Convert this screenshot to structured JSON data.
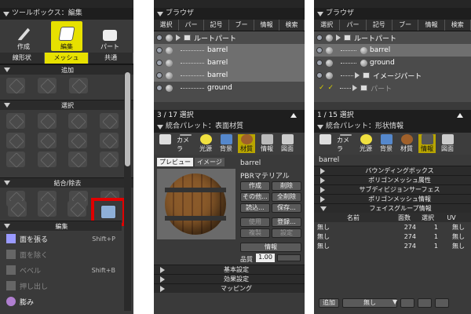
{
  "toolbox": {
    "title": "ツールボックス：編集",
    "modes": [
      "作成",
      "編集",
      "パート"
    ],
    "subtabs": [
      "線形状",
      "メッシュ",
      "共通"
    ],
    "sections": {
      "add": "追加",
      "select": "選択",
      "join": "結合/除去",
      "edit": "編集"
    },
    "edit_items": [
      {
        "label": "面を張る",
        "shortcut": "Shift+P"
      },
      {
        "label": "面を除く",
        "shortcut": ""
      },
      {
        "label": "ベベル",
        "shortcut": "Shift+B"
      },
      {
        "label": "押し出し",
        "shortcut": ""
      },
      {
        "label": "膨み",
        "shortcut": ""
      }
    ],
    "highlight_color": "#e00000"
  },
  "browser1": {
    "title": "ブラウザ",
    "tabs": [
      "選択",
      "パー",
      "記号",
      "ブー",
      "情報",
      "検索"
    ],
    "tree": [
      {
        "label": "ルートパート"
      },
      {
        "label": "barrel"
      },
      {
        "label": "barrel"
      },
      {
        "label": "barrel"
      },
      {
        "label": "ground"
      }
    ],
    "status": "3 / 17 選択"
  },
  "material_panel": {
    "title": "統合パレット：表面材質",
    "icons": [
      "カメラ",
      "光源",
      "背景",
      "材質",
      "情報",
      "図面"
    ],
    "preview_tabs": [
      "プレビュー",
      "イメージ"
    ],
    "object_name": "barrel",
    "material_type": "PBRマテリアル",
    "buttons": [
      "作成",
      "削除",
      "その他...",
      "全削除",
      "読込...",
      "保存...",
      "使用",
      "登録...",
      "複製",
      "設定",
      "情報"
    ],
    "quality_label": "品質",
    "quality_value": "1.00",
    "bars": [
      "基本設定",
      "効果設定",
      "マッピング"
    ]
  },
  "browser2": {
    "title": "ブラウザ",
    "tabs": [
      "選択",
      "パー",
      "記号",
      "ブー",
      "情報",
      "検索"
    ],
    "tree": [
      {
        "label": "ルートパート"
      },
      {
        "label": "barrel"
      },
      {
        "label": "ground"
      },
      {
        "label": "イメージパート"
      },
      {
        "label": "パート"
      }
    ],
    "status": "1 / 15 選択"
  },
  "shape_panel": {
    "title": "統合パレット：形状情報",
    "icons": [
      "カメラ",
      "光源",
      "背景",
      "材質",
      "情報",
      "図面"
    ],
    "object_name": "barrel",
    "bars": [
      "バウンディングボックス",
      "ポリゴンメッシュ属性",
      "サブディビジョンサーフェス",
      "ポリゴンメッシュ情報",
      "フェイスグループ情報"
    ],
    "table_headers": [
      "名前",
      "面数",
      "選択",
      "UV"
    ],
    "rows": [
      [
        "無し",
        "274",
        "1",
        "無し"
      ],
      [
        "無し",
        "274",
        "1",
        "無し"
      ],
      [
        "無し",
        "274",
        "1",
        "無し"
      ]
    ],
    "add_button": "追加",
    "select_value": "無し"
  }
}
